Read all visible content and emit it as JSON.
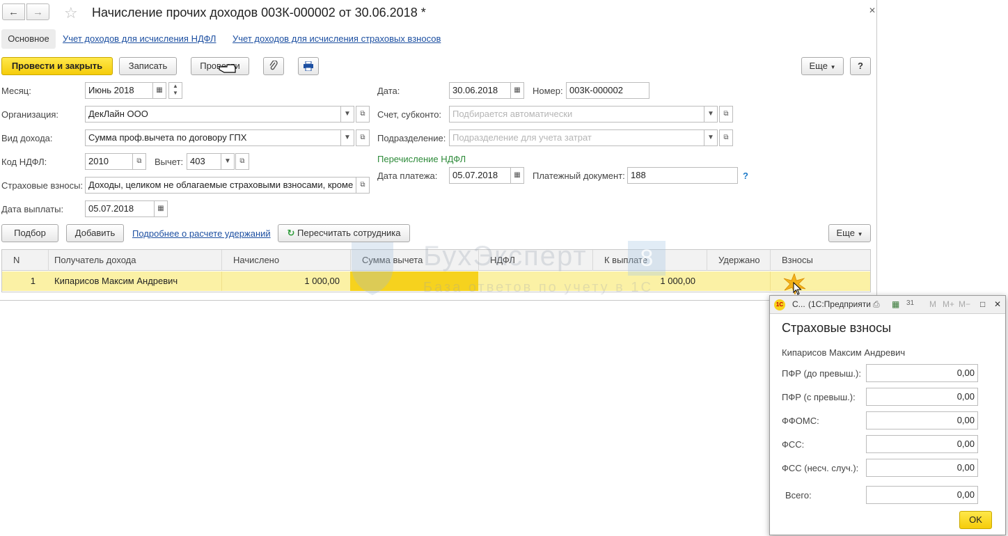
{
  "document": {
    "title": "Начисление прочих доходов 003К-000002 от 30.06.2018 *"
  },
  "tabs": [
    {
      "label": "Основное"
    },
    {
      "label": "Учет доходов для исчисления НДФЛ"
    },
    {
      "label": "Учет доходов для исчисления страховых взносов"
    }
  ],
  "toolbar": {
    "post_close": "Провести и закрыть",
    "save": "Записать",
    "post": "Провести",
    "more": "Еще",
    "help": "?"
  },
  "form": {
    "month_label": "Месяц:",
    "month_value": "Июнь 2018",
    "org_label": "Организация:",
    "org_value": "ДекЛайн ООО",
    "income_type_label": "Вид дохода:",
    "income_type_value": "Сумма проф.вычета по договору ГПХ",
    "ndfl_code_label": "Код НДФЛ:",
    "ndfl_code_value": "2010",
    "deduction_label": "Вычет:",
    "deduction_value": "403",
    "insurance_label": "Страховые взносы:",
    "insurance_value": "Доходы, целиком не облагаемые страховыми взносами, кроме",
    "pay_date_label": "Дата выплаты:",
    "pay_date_value": "05.07.2018",
    "date_label": "Дата:",
    "date_value": "30.06.2018",
    "number_label": "Номер:",
    "number_value": "003К-000002",
    "account_label": "Счет, субконто:",
    "account_placeholder": "Подбирается автоматически",
    "division_label": "Подразделение:",
    "division_placeholder": "Подразделение для учета затрат",
    "ndfl_transfer": "Перечисление НДФЛ",
    "payment_date_label": "Дата платежа:",
    "payment_date_value": "05.07.2018",
    "payment_doc_label": "Платежный документ:",
    "payment_doc_value": "188",
    "help_q": "?"
  },
  "table_toolbar": {
    "pick": "Подбор",
    "add": "Добавить",
    "details_link": "Подробнее о расчете удержаний",
    "recalc": "Пересчитать сотрудника",
    "more": "Еще"
  },
  "table": {
    "columns": [
      "N",
      "Получатель дохода",
      "Начислено",
      "Сумма вычета",
      "НДФЛ",
      "К выплате",
      "Удержано",
      "Взносы"
    ],
    "rows": [
      {
        "n": "1",
        "recipient": "Кипарисов Максим Андревич",
        "accrued": "1 000,00",
        "deduction": "",
        "ndfl": "",
        "payout": "1 000,00",
        "withheld": "",
        "contrib": ""
      }
    ]
  },
  "watermark": {
    "title": "БухЭксперт",
    "badge": "8",
    "subtitle": "База ответов по учету в 1С"
  },
  "popup": {
    "titlebar_short": "С...",
    "titlebar_app": "(1С:Предприятие)",
    "heading": "Страховые взносы",
    "employee": "Кипарисов Максим Андревич",
    "rows": [
      {
        "label": "ПФР (до превыш.):",
        "value": "0,00"
      },
      {
        "label": "ПФР (с превыш.):",
        "value": "0,00"
      },
      {
        "label": "ФФОМС:",
        "value": "0,00"
      },
      {
        "label": "ФСС:",
        "value": "0,00"
      },
      {
        "label": "ФСС (несч. случ.):",
        "value": "0,00"
      }
    ],
    "total_label": "Всего:",
    "total_value": "0,00",
    "ok": "OK"
  },
  "colors": {
    "accent_yellow": "#f5cc0a",
    "row_highlight": "#fbf1a5",
    "link_blue": "#1c4fa1",
    "green_text": "#2e8b3a"
  }
}
